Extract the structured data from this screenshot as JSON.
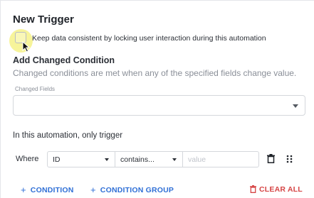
{
  "header": {
    "title": "New Trigger"
  },
  "lock_option": {
    "label": "Keep data consistent by locking user interaction during this automation",
    "checked": false
  },
  "changed_condition": {
    "title": "Add Changed Condition",
    "description": "Changed conditions are met when any of the specified fields change value.",
    "fields_label": "Changed Fields",
    "fields_value": ""
  },
  "trigger_section": {
    "label": "In this automation, only trigger"
  },
  "condition_row": {
    "where_label": "Where",
    "field": "ID",
    "operator": "contains...",
    "value_placeholder": "value"
  },
  "actions": {
    "add_condition": "CONDITION",
    "add_condition_group": "CONDITION GROUP",
    "clear_all": "CLEAR ALL"
  },
  "colors": {
    "primary": "#2f6fd6",
    "danger": "#d64545",
    "muted": "#8a8f98"
  },
  "icons": [
    "cursor-icon",
    "chevron-down-icon",
    "trash-icon",
    "drag-handle-icon",
    "plus-icon"
  ]
}
